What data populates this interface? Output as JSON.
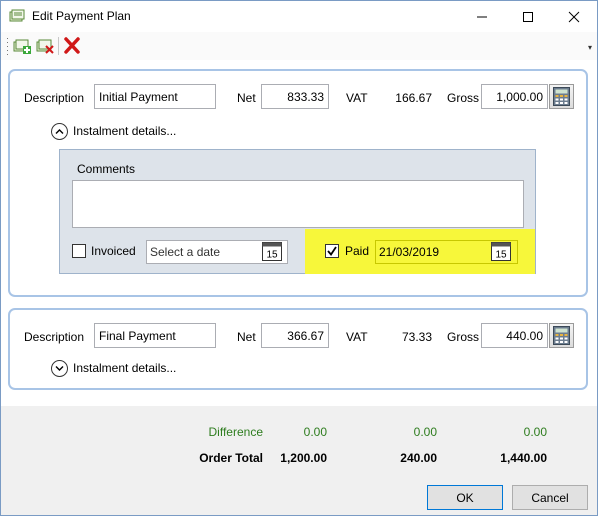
{
  "window": {
    "title": "Edit Payment Plan"
  },
  "toolbar": {
    "add_icon": "add-instalment-icon",
    "remove_icon": "remove-instalment-icon",
    "delete_icon": "delete-icon",
    "overflow": "▾"
  },
  "instalments": [
    {
      "description_label": "Description",
      "description": "Initial Payment",
      "net_label": "Net",
      "net": "833.33",
      "vat_label": "VAT",
      "vat": "166.67",
      "gross_label": "Gross",
      "gross": "1,000.00",
      "expander_label": "Instalment details...",
      "expanded": true,
      "details": {
        "comments_label": "Comments",
        "comments": "",
        "invoiced_label": "Invoiced",
        "invoiced_checked": false,
        "invoiced_date_placeholder": "Select a date",
        "paid_label": "Paid",
        "paid_checked": true,
        "paid_date": "21/03/2019",
        "calendar_day": "15"
      }
    },
    {
      "description_label": "Description",
      "description": "Final Payment",
      "net_label": "Net",
      "net": "366.67",
      "vat_label": "VAT",
      "vat": "73.33",
      "gross_label": "Gross",
      "gross": "440.00",
      "expander_label": "Instalment details...",
      "expanded": false
    }
  ],
  "totals": {
    "difference_label": "Difference",
    "difference": {
      "net": "0.00",
      "vat": "0.00",
      "gross": "0.00"
    },
    "order_total_label": "Order Total",
    "order_total": {
      "net": "1,200.00",
      "vat": "240.00",
      "gross": "1,440.00"
    }
  },
  "buttons": {
    "ok": "OK",
    "cancel": "Cancel"
  },
  "colors": {
    "difference_green": "#2e7d1f",
    "paid_highlight": "#f7f73a",
    "group_border": "#a8c4e6",
    "delete_red": "#d01818"
  }
}
